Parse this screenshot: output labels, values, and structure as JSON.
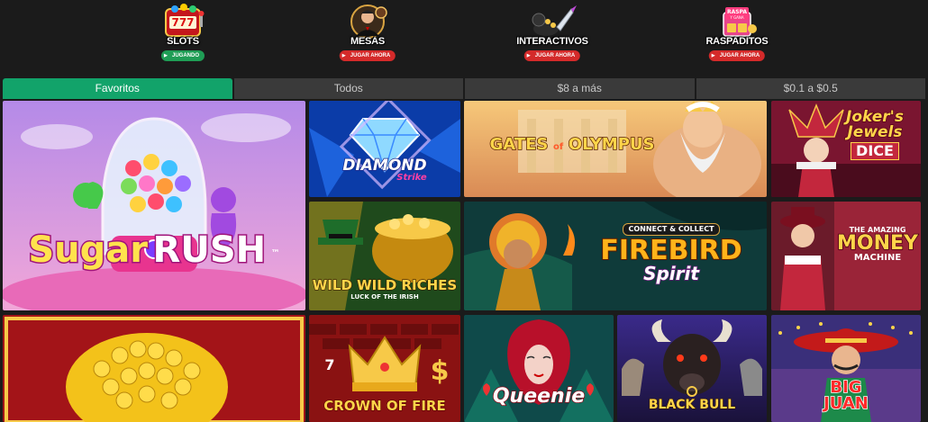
{
  "categories": [
    {
      "label": "SLOTS",
      "badge": "JUGANDO",
      "icon": "slot-machine-icon"
    },
    {
      "label": "MESAS",
      "badge": "JUGAR AHORA",
      "icon": "dealer-icon"
    },
    {
      "label": "INTERACTIVOS",
      "badge": "JUGAR AHORA",
      "icon": "rocket-icon"
    },
    {
      "label": "RASPADITOS",
      "badge": "JUGAR AHORA",
      "icon": "scratch-card-icon",
      "sign_line1": "RASPA",
      "sign_line2": "Y GANA"
    }
  ],
  "tabs": [
    {
      "label": "Favoritos",
      "active": true
    },
    {
      "label": "Todos",
      "active": false
    },
    {
      "label": "$8 a más",
      "active": false
    },
    {
      "label": "$0.1 a $0.5",
      "active": false
    }
  ],
  "games": {
    "sugar_rush": {
      "line1": "Sugar",
      "line2": "RUSH",
      "tm": "™"
    },
    "diamond_strike": {
      "line1": "DIAMOND",
      "line2": "Strike"
    },
    "gates_olympus": {
      "line1": "GATES",
      "of": "of",
      "line2": "OLYMPUS"
    },
    "jokers_jewels": {
      "line1": "Joker's",
      "line2": "Jewels",
      "line3": "DICE"
    },
    "wild_wild_riches": {
      "line1": "WILD WILD RICHES",
      "line2": "LUCK OF THE IRISH"
    },
    "firebird_spirit": {
      "badge": "CONNECT & COLLECT",
      "line1": "FIREBIRD",
      "line2": "Spirit"
    },
    "amazing_money": {
      "line1": "THE AMAZING",
      "line2": "MONEY",
      "line3": "MACHINE"
    },
    "crown_of_fire": {
      "line1": "CROWN OF FIRE",
      "sevens": "7",
      "dollar": "$"
    },
    "queenie": {
      "line1": "Queenie"
    },
    "black_bull": {
      "line1": "BLACK BULL"
    },
    "big_juan": {
      "line1": "BIG",
      "line2": "JUAN"
    }
  }
}
